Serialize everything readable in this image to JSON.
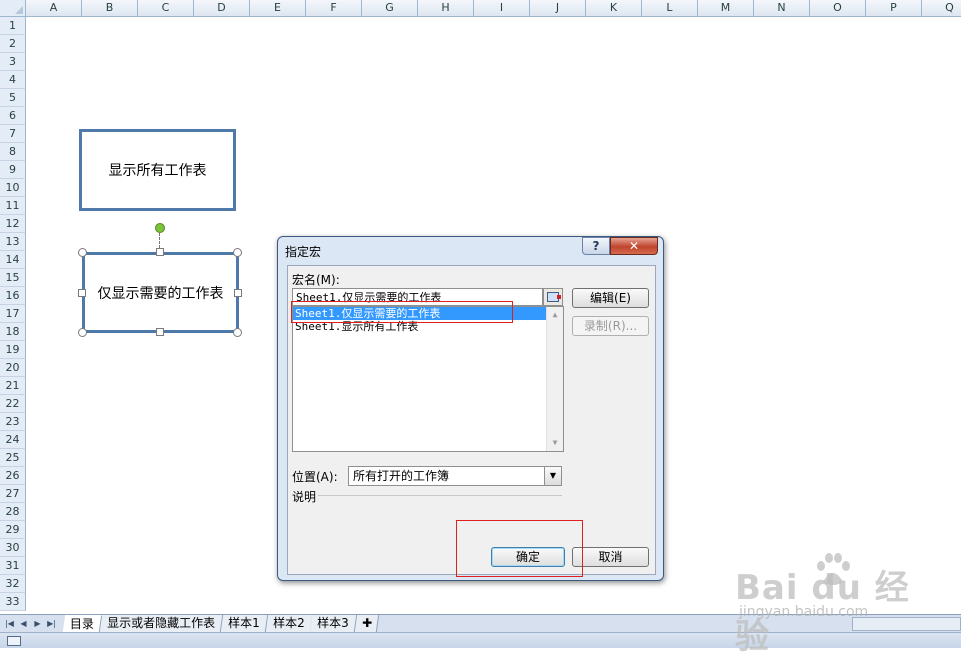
{
  "columns": [
    "A",
    "B",
    "C",
    "D",
    "E",
    "F",
    "G",
    "H",
    "I",
    "J",
    "K",
    "L",
    "M",
    "N",
    "O",
    "P",
    "Q"
  ],
  "rows": [
    "1",
    "2",
    "3",
    "4",
    "5",
    "6",
    "7",
    "8",
    "9",
    "10",
    "11",
    "12",
    "13",
    "14",
    "15",
    "16",
    "17",
    "18",
    "19",
    "20",
    "21",
    "22",
    "23",
    "24",
    "25",
    "26",
    "27",
    "28",
    "29",
    "30",
    "31",
    "32",
    "33"
  ],
  "shapes": {
    "shape1_label": "显示所有工作表",
    "shape2_label": "仅显示需要的工作表"
  },
  "dialog": {
    "title": "指定宏",
    "help_label": "?",
    "close_label": "✕",
    "macro_name_label": "宏名(M):",
    "macro_name_value": "Sheet1.仅显示需要的工作表",
    "macro_list": [
      "Sheet1.仅显示需要的工作表",
      "Sheet1.显示所有工作表"
    ],
    "selected_index": 0,
    "edit_label": "编辑(E)",
    "record_label": "录制(R)...",
    "location_label": "位置(A):",
    "location_value": "所有打开的工作簿",
    "description_label": "说明",
    "ok_label": "确定",
    "cancel_label": "取消"
  },
  "tabs": [
    "目录",
    "显示或者隐藏工作表",
    "样本1",
    "样本2",
    "样本3"
  ],
  "active_tab": 0,
  "watermark": {
    "brand": "Bai du 经验",
    "url": "jingyan.baidu.com"
  },
  "colors": {
    "shape_border": "#4f79a8",
    "selection": "#3399ff",
    "annotation": "#e02020"
  }
}
